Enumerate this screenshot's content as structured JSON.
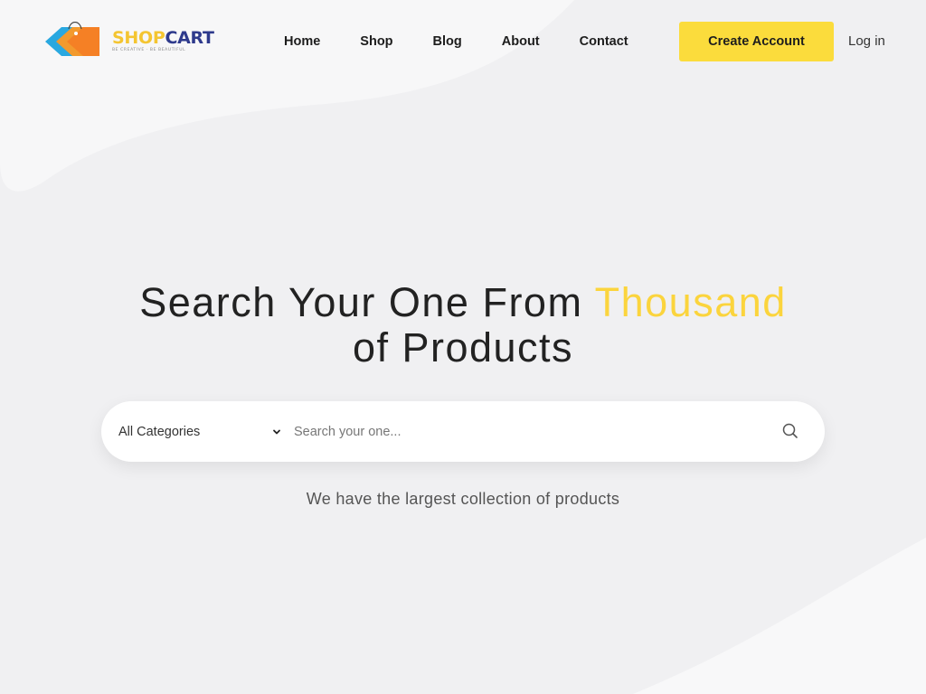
{
  "logo": {
    "brand_first": "SHOP",
    "brand_second": "CART",
    "tagline": "BE CREATIVE · BE BEAUTIFUL",
    "icon": "shopping-tags-icon"
  },
  "nav": {
    "items": [
      {
        "label": "Home"
      },
      {
        "label": "Shop"
      },
      {
        "label": "Blog"
      },
      {
        "label": "About"
      },
      {
        "label": "Contact"
      }
    ]
  },
  "header": {
    "create_account_label": "Create Account",
    "login_label": "Log in"
  },
  "hero": {
    "title_before": "Search Your One From ",
    "title_accent": "Thousand",
    "title_after": " of Products",
    "subtitle": "We have the largest collection of products"
  },
  "search": {
    "category_selected": "All Categories",
    "placeholder": "Search your one...",
    "value": "",
    "search_icon": "search-icon",
    "chevron_icon": "chevron-down-icon"
  },
  "colors": {
    "accent": "#fbd43d",
    "button": "#fbdc3c",
    "background": "#f1f1f3",
    "brand_blue": "#2e3a8c"
  }
}
